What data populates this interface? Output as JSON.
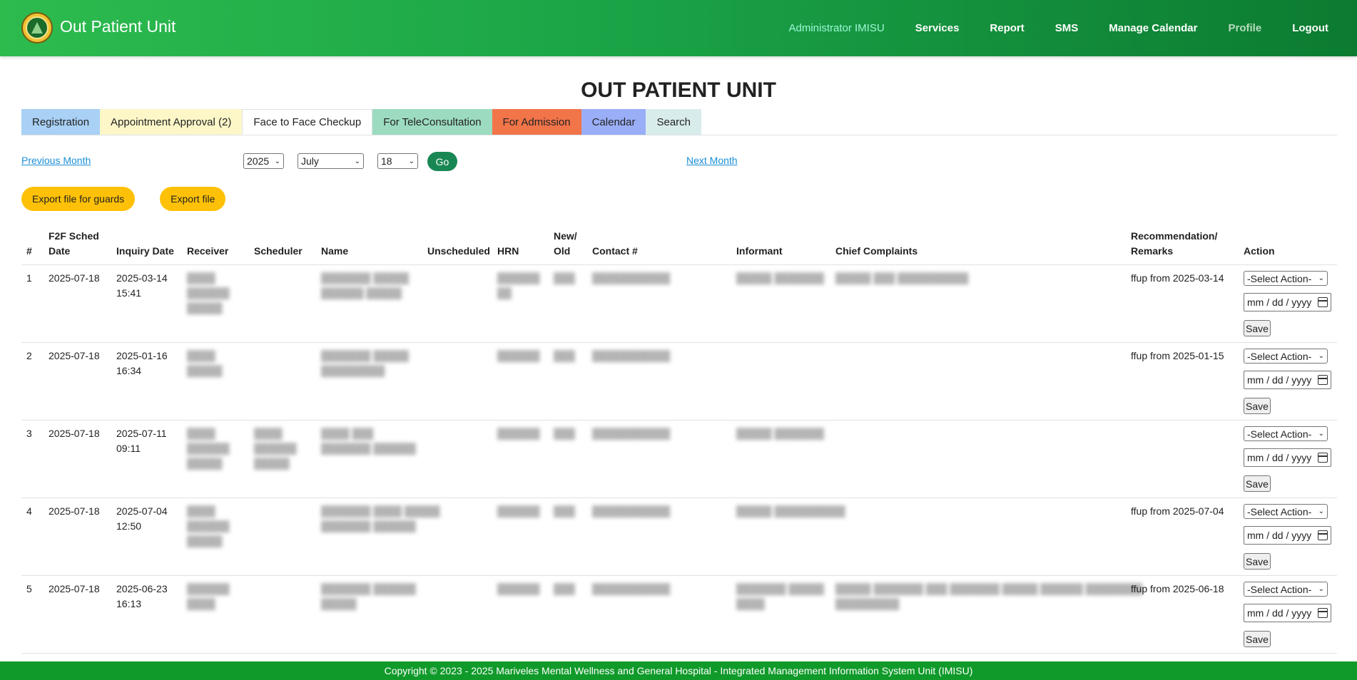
{
  "app": {
    "brand": "Out Patient Unit",
    "page_title": "OUT PATIENT UNIT",
    "footer": "Copyright © 2023 - 2025 Mariveles Mental Wellness and General Hospital - Integrated Management Information System Unit (IMISU)"
  },
  "nav": {
    "items": [
      {
        "label": "Administrator IMISU"
      },
      {
        "label": "Services"
      },
      {
        "label": "Report"
      },
      {
        "label": "SMS"
      },
      {
        "label": "Manage Calendar"
      },
      {
        "label": "Profile"
      },
      {
        "label": "Logout"
      }
    ]
  },
  "tabs": [
    {
      "label": "Registration",
      "color": "#a9d0f5"
    },
    {
      "label": "Appointment Approval (2)",
      "color": "#fdf7c8"
    },
    {
      "label": "Face to Face Checkup",
      "color": "#ffffff",
      "active": true
    },
    {
      "label": "For TeleConsultation",
      "color": "#9cdbc0"
    },
    {
      "label": "For Admission",
      "color": "#f27449"
    },
    {
      "label": "Calendar",
      "color": "#9aaef7"
    },
    {
      "label": "Search",
      "color": "#d9ecec"
    }
  ],
  "date_nav": {
    "prev_label": "Previous Month",
    "next_label": "Next Month",
    "year": "2025",
    "month": "July",
    "day": "18",
    "go_label": "Go"
  },
  "export": {
    "guards_label": "Export file for guards",
    "file_label": "Export file"
  },
  "table": {
    "headers": {
      "num": "#",
      "f2f_1": "F2F Sched",
      "f2f_2": "Date",
      "inquiry": "Inquiry Date",
      "receiver": "Receiver",
      "scheduler": "Scheduler",
      "name": "Name",
      "unscheduled": "Unscheduled",
      "hrn": "HRN",
      "newold_1": "New/",
      "newold_2": "Old",
      "contact": "Contact #",
      "informant": "Informant",
      "chief": "Chief Complaints",
      "reco_1": "Recommendation/",
      "reco_2": "Remarks",
      "action": "Action"
    },
    "select_placeholder": "-Select Action-",
    "date_placeholder": "mm / dd / yyyy",
    "save_label": "Save",
    "rows": [
      {
        "num": "1",
        "sched": "2025-07-18",
        "inq_date": "2025-03-14",
        "inq_time": "15:41",
        "remarks": "ffup from 2025-03-14"
      },
      {
        "num": "2",
        "sched": "2025-07-18",
        "inq_date": "2025-01-16",
        "inq_time": "16:34",
        "remarks": "ffup from 2025-01-15"
      },
      {
        "num": "3",
        "sched": "2025-07-18",
        "inq_date": "2025-07-11",
        "inq_time": "09:11",
        "remarks": ""
      },
      {
        "num": "4",
        "sched": "2025-07-18",
        "inq_date": "2025-07-04",
        "inq_time": "12:50",
        "remarks": "ffup from 2025-07-04"
      },
      {
        "num": "5",
        "sched": "2025-07-18",
        "inq_date": "2025-06-23",
        "inq_time": "16:13",
        "remarks": "ffup from 2025-06-18"
      }
    ]
  },
  "colors": {
    "nav_start": "#2dbb4e",
    "nav_end": "#0c7b31",
    "go_button": "#198754",
    "export_button": "#ffc107",
    "footer": "#109a2a",
    "link": "#1a8fd6"
  }
}
